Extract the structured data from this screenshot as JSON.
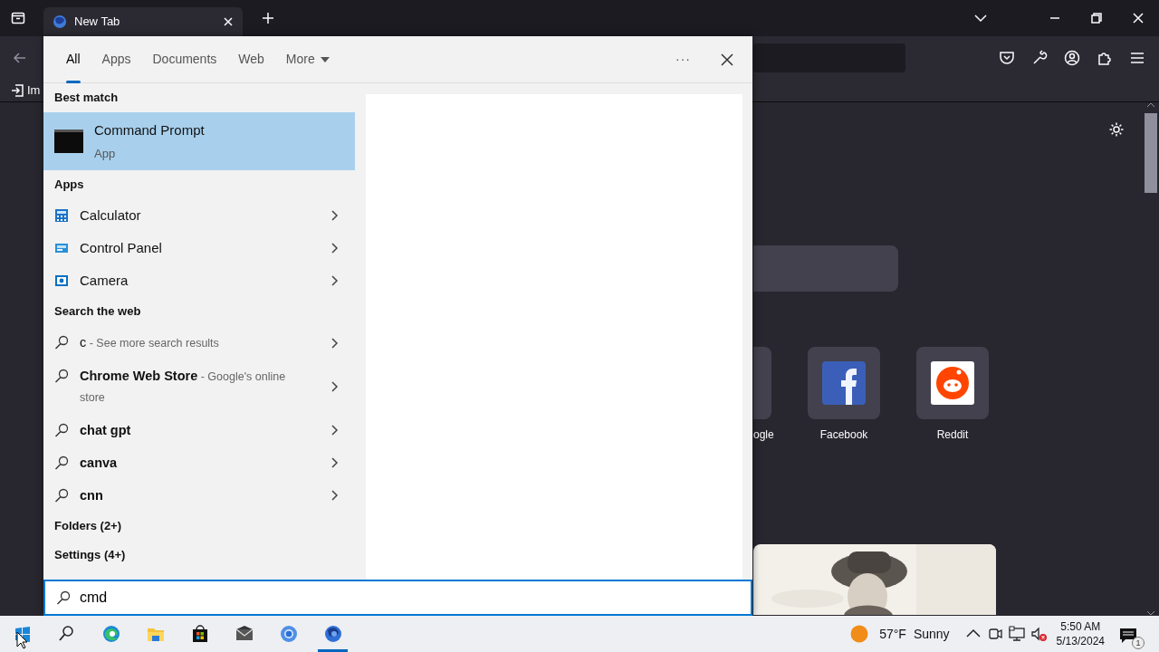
{
  "browser": {
    "tab": {
      "title": "New Tab"
    },
    "bookmark": {
      "label": "Im"
    },
    "shortcuts": [
      {
        "label": "ogle",
        "kind": "partial"
      },
      {
        "label": "Facebook",
        "kind": "facebook"
      },
      {
        "label": "Reddit",
        "kind": "reddit"
      }
    ]
  },
  "search_panel": {
    "tabs": [
      {
        "label": "All",
        "selected": true,
        "menu": false
      },
      {
        "label": "Apps",
        "selected": false,
        "menu": false
      },
      {
        "label": "Documents",
        "selected": false,
        "menu": false
      },
      {
        "label": "Web",
        "selected": false,
        "menu": false
      },
      {
        "label": "More",
        "selected": false,
        "menu": true
      }
    ],
    "options_label": "···",
    "best_match": {
      "header": "Best match",
      "title": "Command Prompt",
      "subtitle": "App",
      "selected": true
    },
    "apps": {
      "header": "Apps",
      "items": [
        {
          "label": "Calculator",
          "kind": "calculator"
        },
        {
          "label": "Control Panel",
          "kind": "control-panel"
        },
        {
          "label": "Camera",
          "kind": "camera"
        }
      ]
    },
    "web": {
      "header": "Search the web",
      "items": [
        {
          "query": "c",
          "bold": false,
          "suffix": "- See more search results"
        },
        {
          "query": "Chrome Web Store",
          "bold": true,
          "suffix": "- Google's online store"
        },
        {
          "query": "chat gpt",
          "bold": true
        },
        {
          "query": "canva",
          "bold": true
        },
        {
          "query": "cnn",
          "bold": true
        }
      ]
    },
    "groups": [
      {
        "label": "Folders (2+)"
      },
      {
        "label": "Settings (4+)"
      }
    ],
    "search_box": {
      "value": "cmd"
    }
  },
  "taskbar": {
    "apps": [
      {
        "kind": "start",
        "active": false
      },
      {
        "kind": "search",
        "active": false
      },
      {
        "kind": "edge",
        "active": false
      },
      {
        "kind": "explorer",
        "active": false
      },
      {
        "kind": "store",
        "active": false
      },
      {
        "kind": "mail",
        "active": false
      },
      {
        "kind": "chrome",
        "active": false
      },
      {
        "kind": "firefox",
        "active": true
      }
    ],
    "weather": {
      "temperature": "57°F",
      "condition": "Sunny"
    },
    "tray": [
      {
        "kind": "chevron"
      },
      {
        "kind": "meet"
      },
      {
        "kind": "network"
      },
      {
        "kind": "volume-muted"
      }
    ],
    "clock": {
      "time": "5:50 AM",
      "date": "5/13/2024"
    },
    "notifications": {
      "count": "1"
    }
  }
}
